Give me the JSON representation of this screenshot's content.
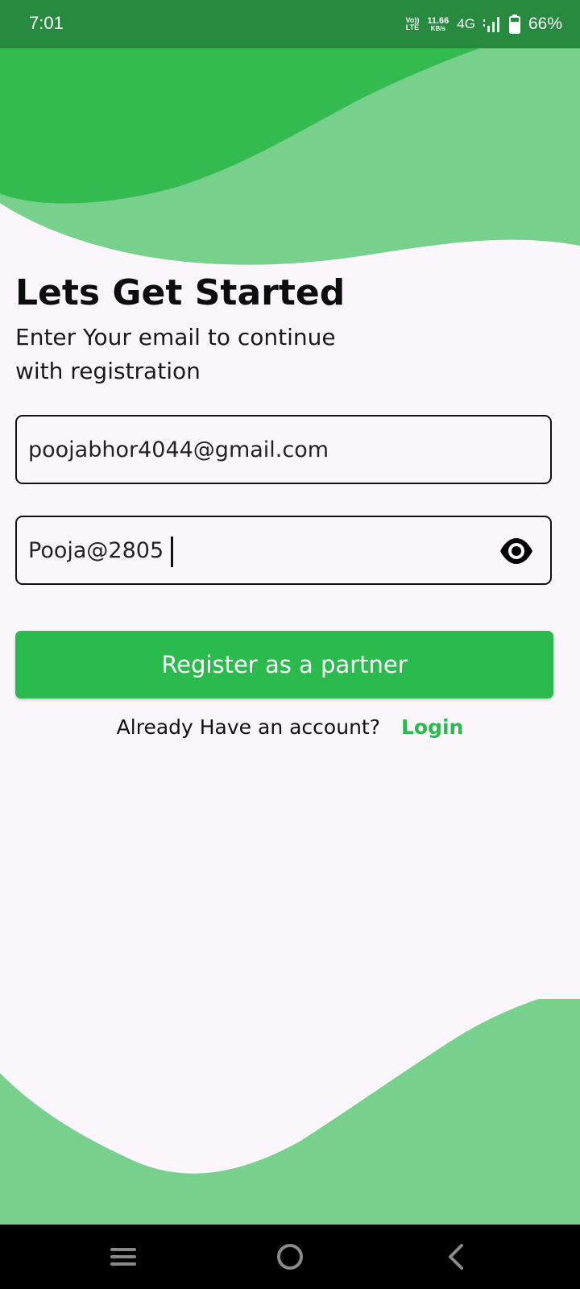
{
  "status_bar": {
    "time": "7:01",
    "volte_line1": "Vo))",
    "volte_line2": "LTE",
    "net_speed_value": "11.66",
    "net_speed_unit": "KB/s",
    "network_type": "4G",
    "battery_percent": "66%",
    "icons": [
      "volte-icon",
      "signal-icon",
      "battery-icon"
    ]
  },
  "header": {
    "title": "Lets Get Started",
    "subtitle": "Enter Your email to continue with registration"
  },
  "form": {
    "email_value": "poojabhor4044@gmail.com",
    "password_value": "Pooja@2805",
    "password_toggle_icon": "eye-icon",
    "submit_label": "Register as a partner"
  },
  "footer_prompt": {
    "text": "Already Have an account?",
    "link_label": "Login"
  },
  "nav_bar": {
    "icons": [
      "menu-icon",
      "home-icon",
      "back-icon"
    ]
  },
  "colors": {
    "status_bar": "#278a3e",
    "accent_green": "#2bba4e",
    "wave_dark": "#33bb50",
    "wave_light": "#77d18c",
    "background": "#fbf6fc"
  }
}
